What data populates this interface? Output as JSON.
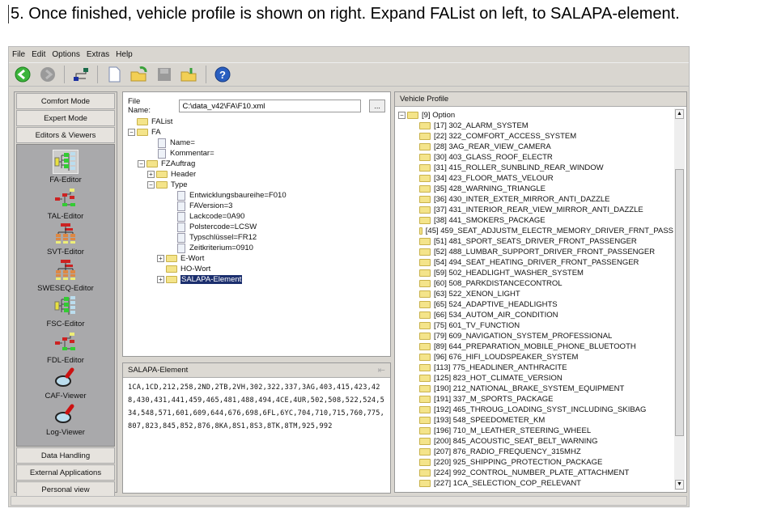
{
  "caption": "5. Once finished, vehicle profile is shown on right. Expand FAList on left, to SALAPA-element.",
  "menu": [
    "File",
    "Edit",
    "Options",
    "Extras",
    "Help"
  ],
  "toolbar": [
    "back-icon",
    "forward-icon",
    "connect-icon",
    "new-file-icon",
    "open-folder-icon",
    "save-icon",
    "import-folder-icon",
    "help-icon"
  ],
  "sidebar": {
    "top": [
      "Comfort Mode",
      "Expert Mode",
      "Editors & Viewers"
    ],
    "editors": [
      {
        "label": "FA-Editor",
        "selected": true
      },
      {
        "label": "TAL-Editor"
      },
      {
        "label": "SVT-Editor"
      },
      {
        "label": "SWESEQ-Editor"
      },
      {
        "label": "FSC-Editor"
      },
      {
        "label": "FDL-Editor"
      },
      {
        "label": "CAF-Viewer"
      },
      {
        "label": "Log-Viewer"
      }
    ],
    "bottom": [
      "Data Handling",
      "External Applications",
      "Personal view"
    ]
  },
  "file": {
    "label": "File Name:",
    "value": "C:\\data_v42\\FA\\F10.xml",
    "browse": "..."
  },
  "fa_tree": [
    {
      "level": 0,
      "type": "folder",
      "label": "FAList"
    },
    {
      "level": 0,
      "type": "folder",
      "label": "FA",
      "exp": "-"
    },
    {
      "level": 2,
      "type": "doc",
      "label": "Name="
    },
    {
      "level": 2,
      "type": "doc",
      "label": "Kommentar="
    },
    {
      "level": 1,
      "type": "folder",
      "label": "FZAuftrag",
      "exp": "-"
    },
    {
      "level": 2,
      "type": "folder",
      "label": "Header",
      "exp": "+"
    },
    {
      "level": 2,
      "type": "folder",
      "label": "Type",
      "exp": "-"
    },
    {
      "level": 4,
      "type": "doc",
      "label": "Entwicklungsbaureihe=F010"
    },
    {
      "level": 4,
      "type": "doc",
      "label": "FAVersion=3"
    },
    {
      "level": 4,
      "type": "doc",
      "label": "Lackcode=0A90"
    },
    {
      "level": 4,
      "type": "doc",
      "label": "Polstercode=LCSW"
    },
    {
      "level": 4,
      "type": "doc",
      "label": "Typschlüssel=FR12"
    },
    {
      "level": 4,
      "type": "doc",
      "label": "Zeitkriterium=0910"
    },
    {
      "level": 3,
      "type": "folder",
      "label": "E-Wort",
      "exp": "+"
    },
    {
      "level": 3,
      "type": "folder",
      "label": "HO-Wort",
      "exp": " "
    },
    {
      "level": 3,
      "type": "folder",
      "label": "SALAPA-Element",
      "exp": "+",
      "selected": true
    }
  ],
  "salapa": {
    "title": "SALAPA-Element",
    "text": "1CA,1CD,212,258,2ND,2TB,2VH,302,322,337,3AG,403,415,423,428,430,431,441,459,465,481,488,494,4CE,4UR,502,508,522,524,534,548,571,601,609,644,676,698,6FL,6YC,704,710,715,760,775,807,823,845,852,876,8KA,8S1,8S3,8TK,8TM,925,992"
  },
  "vehicle_profile": {
    "title": "Vehicle Profile",
    "root": "[9] Option",
    "items": [
      "[17] 302_ALARM_SYSTEM",
      "[22] 322_COMFORT_ACCESS_SYSTEM",
      "[28] 3AG_REAR_VIEW_CAMERA",
      "[30] 403_GLASS_ROOF_ELECTR",
      "[31] 415_ROLLER_SUNBLIND_REAR_WINDOW",
      "[34] 423_FLOOR_MATS_VELOUR",
      "[35] 428_WARNING_TRIANGLE",
      "[36] 430_INTER_EXTER_MIRROR_ANTI_DAZZLE",
      "[37] 431_INTERIOR_REAR_VIEW_MIRROR_ANTI_DAZZLE",
      "[38] 441_SMOKERS_PACKAGE",
      "[45] 459_SEAT_ADJUSTM_ELECTR_MEMORY_DRIVER_FRNT_PASS",
      "[51] 481_SPORT_SEATS_DRIVER_FRONT_PASSENGER",
      "[52] 488_LUMBAR_SUPPORT_DRIVER_FRONT_PASSENGER",
      "[54] 494_SEAT_HEATING_DRIVER_FRONT_PASSENGER",
      "[59] 502_HEADLIGHT_WASHER_SYSTEM",
      "[60] 508_PARKDISTANCECONTROL",
      "[63] 522_XENON_LIGHT",
      "[65] 524_ADAPTIVE_HEADLIGHTS",
      "[66] 534_AUTOM_AIR_CONDITION",
      "[75] 601_TV_FUNCTION",
      "[79] 609_NAVIGATION_SYSTEM_PROFESSIONAL",
      "[89] 644_PREPARATION_MOBILE_PHONE_BLUETOOTH",
      "[96] 676_HIFI_LOUDSPEAKER_SYSTEM",
      "[113] 775_HEADLINER_ANTHRACITE",
      "[125] 823_HOT_CLIMATE_VERSION",
      "[190] 212_NATIONAL_BRAKE_SYSTEM_EQUIPMENT",
      "[191] 337_M_SPORTS_PACKAGE",
      "[192] 465_THROUG_LOADING_SYST_INCLUDING_SKIBAG",
      "[193] 548_SPEEDOMETER_KM",
      "[196] 710_M_LEATHER_STEERING_WHEEL",
      "[200] 845_ACOUSTIC_SEAT_BELT_WARNING",
      "[207] 876_RADIO_FREQUENCY_315MHZ",
      "[220] 925_SHIPPING_PROTECTION_PACKAGE",
      "[224] 992_CONTROL_NUMBER_PLATE_ATTACHMENT",
      "[227] 1CA_SELECTION_COP_RELEVANT"
    ]
  }
}
